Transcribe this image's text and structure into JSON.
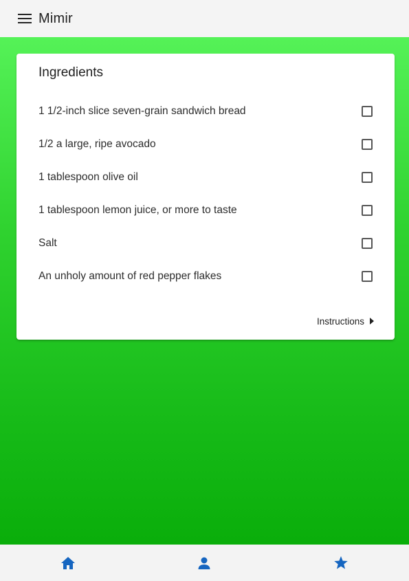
{
  "app": {
    "title": "Mimir",
    "accent_color": "#1565c0",
    "background_gradient": [
      "#5cf85f",
      "#06aa06"
    ]
  },
  "topbar": {
    "menu_icon": "menu-icon"
  },
  "card": {
    "title": "Ingredients",
    "ingredients": [
      {
        "label": "1 1/2-inch slice seven-grain sandwich bread",
        "checked": false
      },
      {
        "label": "1/2 a large, ripe avocado",
        "checked": false
      },
      {
        "label": "1 tablespoon olive oil",
        "checked": false
      },
      {
        "label": "1 tablespoon lemon juice, or more to taste",
        "checked": false
      },
      {
        "label": "Salt",
        "checked": false
      },
      {
        "label": "An unholy amount of red pepper flakes",
        "checked": false
      }
    ],
    "instructions_label": "Instructions",
    "instructions_icon": "arrow-right-icon"
  },
  "bottom_nav": {
    "items": [
      {
        "icon": "home-icon"
      },
      {
        "icon": "person-icon"
      },
      {
        "icon": "star-icon"
      }
    ]
  }
}
